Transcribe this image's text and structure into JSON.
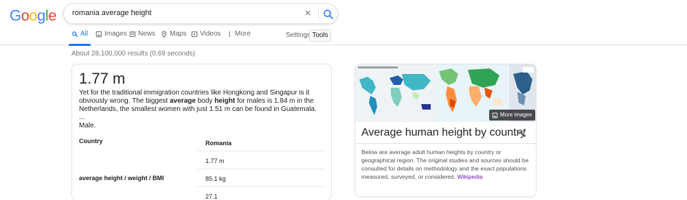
{
  "header": {
    "logo": [
      "G",
      "o",
      "o",
      "g",
      "l",
      "e"
    ],
    "logo_colors": [
      "#4285f4",
      "#ea4335",
      "#fbbc05",
      "#4285f4",
      "#34a853",
      "#ea4335"
    ],
    "search_query": "romania average height",
    "clear_icon": "×"
  },
  "tabs": [
    {
      "label": "All",
      "icon": "search-icon",
      "active": true
    },
    {
      "label": "Images",
      "icon": "image-icon"
    },
    {
      "label": "News",
      "icon": "news-icon"
    },
    {
      "label": "Maps",
      "icon": "map-pin-icon"
    },
    {
      "label": "Videos",
      "icon": "play-icon"
    },
    {
      "label": "More",
      "icon": "more-vert-icon"
    }
  ],
  "settings_label": "Settings",
  "tools_label": "Tools",
  "stats": "About 28,100,000 results (0.69 seconds)",
  "answer": {
    "headline": "1.77 m",
    "snippet_1": "Yet for the traditional immigration countries like Hongkong and Singapur is it obviously wrong. The biggest ",
    "snippet_b1": "average",
    "snippet_2": " body ",
    "snippet_b2": "height",
    "snippet_3": " for males is 1.84 m in the Netherlands, the smallest women with just 1.51 m can be found in Guatemala.",
    "ellipsis": "...",
    "male": "Male.",
    "table": {
      "col1_header": "Country",
      "col2_header": "Romania",
      "row_label_b1": "average",
      "row_label_n1": " ",
      "row_label_b2": "height",
      "row_label_n2": " / weight / BMI",
      "values": [
        "1.77 m",
        "85.1 kg",
        "27.1"
      ]
    }
  },
  "knowledge_panel": {
    "more_images": "More images",
    "title": "Average human height by country",
    "description": "Below are average adult human heights by country or geographical region. The original studies and sources should be consulted for details on methodology and the exact populations measured, surveyed, or considered.",
    "source_link": "Wikipedia",
    "share_icon": "share-icon"
  },
  "colors": {
    "accent": "#1a73e8",
    "link_visited": "#681da8",
    "muted": "#70757a"
  }
}
